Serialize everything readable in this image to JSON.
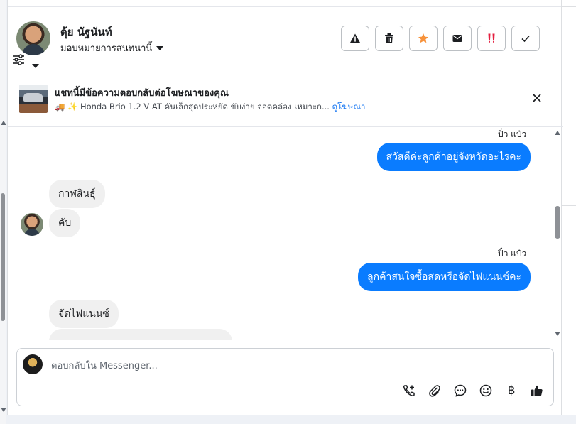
{
  "header": {
    "contact_name": "ดุ้ย นัฐนันท์",
    "assign_label": "มอบหมายการสนทนานี้"
  },
  "action_buttons": [
    {
      "name": "warning-icon"
    },
    {
      "name": "trash-icon"
    },
    {
      "name": "star-icon",
      "color": "#f7923b"
    },
    {
      "name": "mail-icon"
    },
    {
      "name": "double-exclamation-icon",
      "color": "#e41e3f"
    },
    {
      "name": "check-icon"
    }
  ],
  "ad": {
    "title": "แชทนี้มีข้อความตอบกลับต่อโฆษณาของคุณ",
    "description": "🚚 ✨ Honda Brio 1.2 V AT คันเล็กสุดประหยัด ขับง่าย จอดคล่อง เหมาะก...",
    "link_label": "ดูโฆษณา"
  },
  "messages": [
    {
      "direction": "out",
      "sender": "ปิ๋ว แป๋ว",
      "text": "สวัสดีค่ะลูกค้าอยู่จังหวัดอะไรคะ"
    },
    {
      "direction": "in",
      "text": "กาฬสินธุ์"
    },
    {
      "direction": "in",
      "text": "คับ"
    },
    {
      "direction": "out",
      "sender": "ปิ๋ว แป๋ว",
      "text": "ลูกค้าสนใจซื้อสดหรือจัดไฟแนนซ์คะ"
    },
    {
      "direction": "in",
      "text": "จัดไฟแนนซ์"
    }
  ],
  "composer": {
    "placeholder": "ตอบกลับใน Messenger...",
    "currency_symbol": "฿"
  },
  "colors": {
    "outgoing_bubble": "#0a7cff",
    "incoming_bubble": "#f0f0f0",
    "link": "#1877f2"
  }
}
